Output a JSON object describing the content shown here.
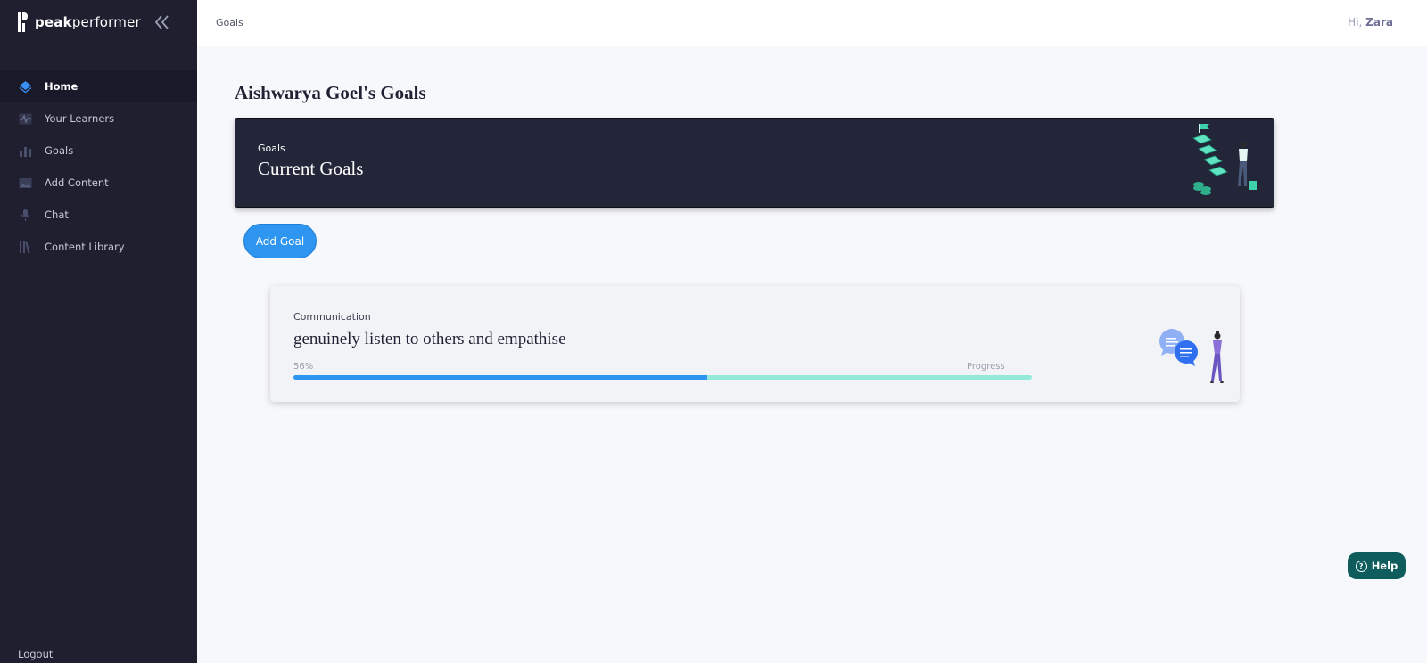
{
  "brand": {
    "name_bold": "peak",
    "name_rest": "performer"
  },
  "sidebar": {
    "items": [
      {
        "label": "Home",
        "icon": "diamond-icon",
        "active": true
      },
      {
        "label": "Your Learners",
        "icon": "activity-icon",
        "active": false
      },
      {
        "label": "Goals",
        "icon": "bar-chart-icon",
        "active": false
      },
      {
        "label": "Add Content",
        "icon": "image-icon",
        "active": false
      },
      {
        "label": "Chat",
        "icon": "microphone-icon",
        "active": false
      },
      {
        "label": "Content Library",
        "icon": "library-icon",
        "active": false
      }
    ],
    "logout_label": "Logout"
  },
  "header": {
    "breadcrumb": "Goals",
    "greeting_prefix": "Hi,",
    "user_name": "Zara"
  },
  "main": {
    "page_title": "Aishwarya Goel's Goals",
    "banner": {
      "subtitle": "Goals",
      "title": "Current Goals"
    },
    "add_goal_label": "Add Goal",
    "goals": [
      {
        "category": "Communication",
        "title": "genuinely listen to others and empathise",
        "percent_label": "56%",
        "progress": 0.56,
        "progress_label": "Progress"
      }
    ]
  },
  "help": {
    "label": "Help"
  },
  "colors": {
    "sidebar_bg": "#1f1f2f",
    "banner_bg": "#222638",
    "accent_blue": "#2e95f0",
    "progress_track": "#93ead8",
    "help_bg": "#0f5c5c"
  }
}
